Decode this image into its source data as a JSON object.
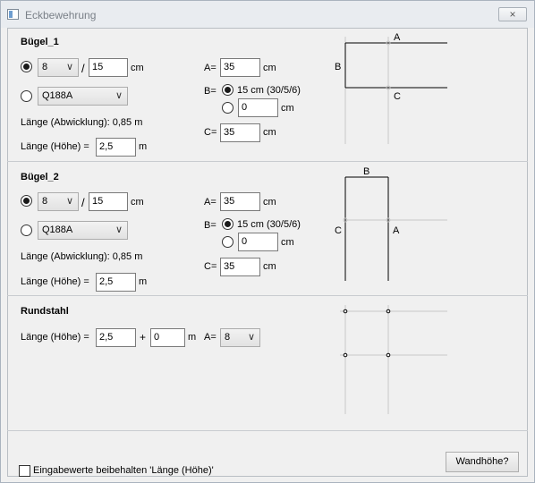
{
  "window": {
    "title": "Eckbewehrung",
    "close_icon": "×"
  },
  "buegel1": {
    "title": "Bügel_1",
    "bar_diameter": "8",
    "slash": "/",
    "spacing": "15",
    "spacing_unit": "cm",
    "mesh": "Q188A",
    "laenge_abw": "Länge (Abwicklung): 0,85 m",
    "laenge_hoehe_label": "Länge (Höhe) =",
    "laenge_hoehe_value": "2,5",
    "laenge_hoehe_unit": "m",
    "a_label": "A=",
    "a_value": "35",
    "a_unit": "cm",
    "b_label": "B=",
    "b_option1": "15 cm (30/5/6)",
    "b_value": "0",
    "b_unit": "cm",
    "c_label": "C=",
    "c_value": "35",
    "c_unit": "cm",
    "diagram": {
      "a": "A",
      "b": "B",
      "c": "C"
    }
  },
  "buegel2": {
    "title": "Bügel_2",
    "bar_diameter": "8",
    "slash": "/",
    "spacing": "15",
    "spacing_unit": "cm",
    "mesh": "Q188A",
    "laenge_abw": "Länge (Abwicklung): 0,85 m",
    "laenge_hoehe_label": "Länge (Höhe) =",
    "laenge_hoehe_value": "2,5",
    "laenge_hoehe_unit": "m",
    "a_label": "A=",
    "a_value": "35",
    "a_unit": "cm",
    "b_label": "B=",
    "b_option1": "15 cm (30/5/6)",
    "b_value": "0",
    "b_unit": "cm",
    "c_label": "C=",
    "c_value": "35",
    "c_unit": "cm",
    "diagram": {
      "a": "A",
      "b": "B",
      "c": "C"
    }
  },
  "rundstahl": {
    "title": "Rundstahl",
    "laenge_hoehe_label": "Länge (Höhe) =",
    "value1": "2,5",
    "plus": "+",
    "value2": "0",
    "unit": "m",
    "a_label": "A=",
    "a_value": "8"
  },
  "footer": {
    "checkbox_label": "Eingabewerte beibehalten 'Länge (Höhe)'",
    "wandhoehe_button": "Wandhöhe?"
  },
  "icons": {
    "chevron": "∨"
  }
}
